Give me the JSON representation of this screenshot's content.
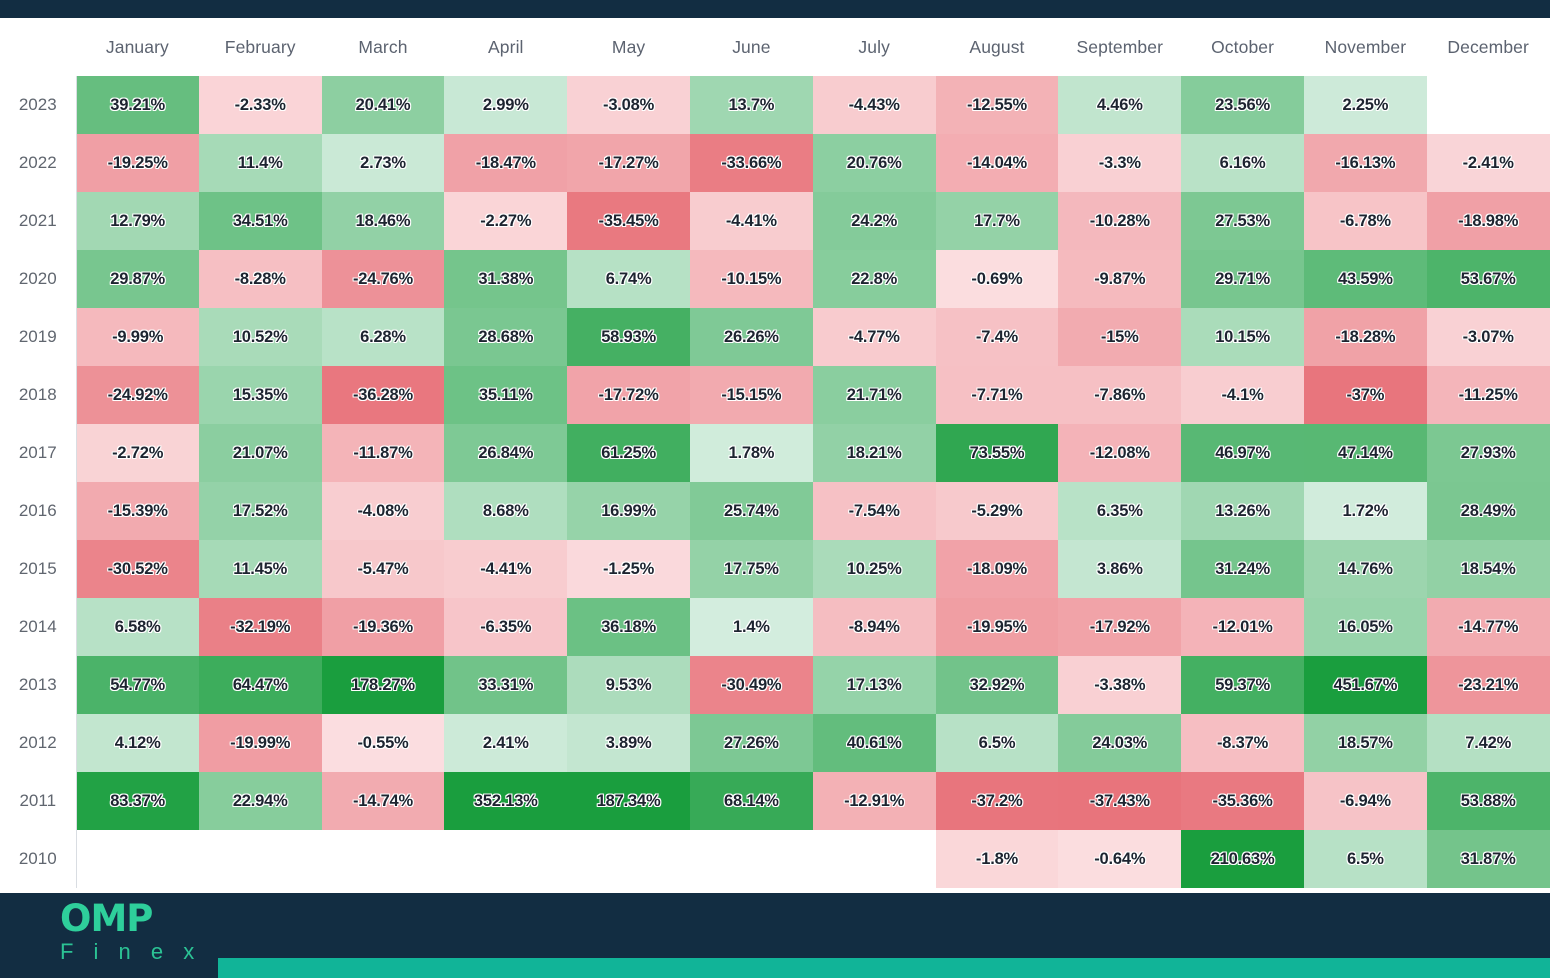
{
  "brand": {
    "name_top": "OMP",
    "name_bottom": "F i n e x",
    "accent": "#2ecf9b",
    "bar_color": "#11b498",
    "chrome_color": "#122d42"
  },
  "table": {
    "year_header": "",
    "months": [
      "January",
      "February",
      "March",
      "April",
      "May",
      "June",
      "July",
      "August",
      "September",
      "October",
      "November",
      "December"
    ],
    "years": [
      "2023",
      "2022",
      "2021",
      "2020",
      "2019",
      "2018",
      "2017",
      "2016",
      "2015",
      "2014",
      "2013",
      "2012",
      "2011",
      "2010"
    ]
  },
  "chart_data": {
    "type": "heatmap",
    "title": "",
    "xlabel": "",
    "ylabel": "",
    "unit": "%",
    "categories": [
      "January",
      "February",
      "March",
      "April",
      "May",
      "June",
      "July",
      "August",
      "September",
      "October",
      "November",
      "December"
    ],
    "rows": [
      "2023",
      "2022",
      "2021",
      "2020",
      "2019",
      "2018",
      "2017",
      "2016",
      "2015",
      "2014",
      "2013",
      "2012",
      "2011",
      "2010"
    ],
    "colorscale": {
      "min_color": "#e8737b",
      "mid_color": "#f5f9f7",
      "max_color": "#1a9e3e",
      "negative": "red",
      "positive": "green"
    },
    "values": [
      [
        39.21,
        -2.33,
        20.41,
        2.99,
        -3.08,
        13.7,
        -4.43,
        -12.55,
        4.46,
        23.56,
        2.25,
        null
      ],
      [
        -19.25,
        11.4,
        2.73,
        -18.47,
        -17.27,
        -33.66,
        20.76,
        -14.04,
        -3.3,
        6.16,
        -16.13,
        -2.41
      ],
      [
        12.79,
        34.51,
        18.46,
        -2.27,
        -35.45,
        -4.41,
        24.2,
        17.7,
        -10.28,
        27.53,
        -6.78,
        -18.98
      ],
      [
        29.87,
        -8.28,
        -24.76,
        31.38,
        6.74,
        -10.15,
        22.8,
        -0.69,
        -9.87,
        29.71,
        43.59,
        53.67
      ],
      [
        -9.99,
        10.52,
        6.28,
        28.68,
        58.93,
        26.26,
        -4.77,
        -7.4,
        -15,
        10.15,
        -18.28,
        -3.07
      ],
      [
        -24.92,
        15.35,
        -36.28,
        35.11,
        -17.72,
        -15.15,
        21.71,
        -7.71,
        -7.86,
        -4.1,
        -37,
        -11.25
      ],
      [
        -2.72,
        21.07,
        -11.87,
        26.84,
        61.25,
        1.78,
        18.21,
        73.55,
        -12.08,
        46.97,
        47.14,
        27.93
      ],
      [
        -15.39,
        17.52,
        -4.08,
        8.68,
        16.99,
        25.74,
        -7.54,
        -5.29,
        6.35,
        13.26,
        1.72,
        28.49
      ],
      [
        -30.52,
        11.45,
        -5.47,
        -4.41,
        -1.25,
        17.75,
        10.25,
        -18.09,
        3.86,
        31.24,
        14.76,
        18.54
      ],
      [
        6.58,
        -32.19,
        -19.36,
        -6.35,
        36.18,
        1.4,
        -8.94,
        -19.95,
        -17.92,
        -12.01,
        16.05,
        -14.77
      ],
      [
        54.77,
        64.47,
        178.27,
        33.31,
        9.53,
        -30.49,
        17.13,
        32.92,
        -3.38,
        59.37,
        451.67,
        -23.21
      ],
      [
        4.12,
        -19.99,
        -0.55,
        2.41,
        3.89,
        27.26,
        40.61,
        6.5,
        24.03,
        -8.37,
        18.57,
        7.42
      ],
      [
        83.37,
        22.94,
        -14.74,
        352.13,
        187.34,
        68.14,
        -12.91,
        -37.2,
        -37.43,
        -35.36,
        -6.94,
        53.88
      ],
      [
        null,
        null,
        null,
        null,
        null,
        null,
        null,
        -1.8,
        -0.64,
        210.63,
        6.5,
        31.87
      ]
    ],
    "labels": [
      [
        "39.21%",
        "-2.33%",
        "20.41%",
        "2.99%",
        "-3.08%",
        "13.7%",
        "-4.43%",
        "-12.55%",
        "4.46%",
        "23.56%",
        "2.25%",
        ""
      ],
      [
        "-19.25%",
        "11.4%",
        "2.73%",
        "-18.47%",
        "-17.27%",
        "-33.66%",
        "20.76%",
        "-14.04%",
        "-3.3%",
        "6.16%",
        "-16.13%",
        "-2.41%"
      ],
      [
        "12.79%",
        "34.51%",
        "18.46%",
        "-2.27%",
        "-35.45%",
        "-4.41%",
        "24.2%",
        "17.7%",
        "-10.28%",
        "27.53%",
        "-6.78%",
        "-18.98%"
      ],
      [
        "29.87%",
        "-8.28%",
        "-24.76%",
        "31.38%",
        "6.74%",
        "-10.15%",
        "22.8%",
        "-0.69%",
        "-9.87%",
        "29.71%",
        "43.59%",
        "53.67%"
      ],
      [
        "-9.99%",
        "10.52%",
        "6.28%",
        "28.68%",
        "58.93%",
        "26.26%",
        "-4.77%",
        "-7.4%",
        "-15%",
        "10.15%",
        "-18.28%",
        "-3.07%"
      ],
      [
        "-24.92%",
        "15.35%",
        "-36.28%",
        "35.11%",
        "-17.72%",
        "-15.15%",
        "21.71%",
        "-7.71%",
        "-7.86%",
        "-4.1%",
        "-37%",
        "-11.25%"
      ],
      [
        "-2.72%",
        "21.07%",
        "-11.87%",
        "26.84%",
        "61.25%",
        "1.78%",
        "18.21%",
        "73.55%",
        "-12.08%",
        "46.97%",
        "47.14%",
        "27.93%"
      ],
      [
        "-15.39%",
        "17.52%",
        "-4.08%",
        "8.68%",
        "16.99%",
        "25.74%",
        "-7.54%",
        "-5.29%",
        "6.35%",
        "13.26%",
        "1.72%",
        "28.49%"
      ],
      [
        "-30.52%",
        "11.45%",
        "-5.47%",
        "-4.41%",
        "-1.25%",
        "17.75%",
        "10.25%",
        "-18.09%",
        "3.86%",
        "31.24%",
        "14.76%",
        "18.54%"
      ],
      [
        "6.58%",
        "-32.19%",
        "-19.36%",
        "-6.35%",
        "36.18%",
        "1.4%",
        "-8.94%",
        "-19.95%",
        "-17.92%",
        "-12.01%",
        "16.05%",
        "-14.77%"
      ],
      [
        "54.77%",
        "64.47%",
        "178.27%",
        "33.31%",
        "9.53%",
        "-30.49%",
        "17.13%",
        "32.92%",
        "-3.38%",
        "59.37%",
        "451.67%",
        "-23.21%"
      ],
      [
        "4.12%",
        "-19.99%",
        "-0.55%",
        "2.41%",
        "3.89%",
        "27.26%",
        "40.61%",
        "6.5%",
        "24.03%",
        "-8.37%",
        "18.57%",
        "7.42%"
      ],
      [
        "83.37%",
        "22.94%",
        "-14.74%",
        "352.13%",
        "187.34%",
        "68.14%",
        "-12.91%",
        "-37.2%",
        "-37.43%",
        "-35.36%",
        "-6.94%",
        "53.88%"
      ],
      [
        "",
        "",
        "",
        "",
        "",
        "",
        "",
        "-1.8%",
        "-0.64%",
        "210.63%",
        "6.5%",
        "31.87%"
      ]
    ]
  }
}
